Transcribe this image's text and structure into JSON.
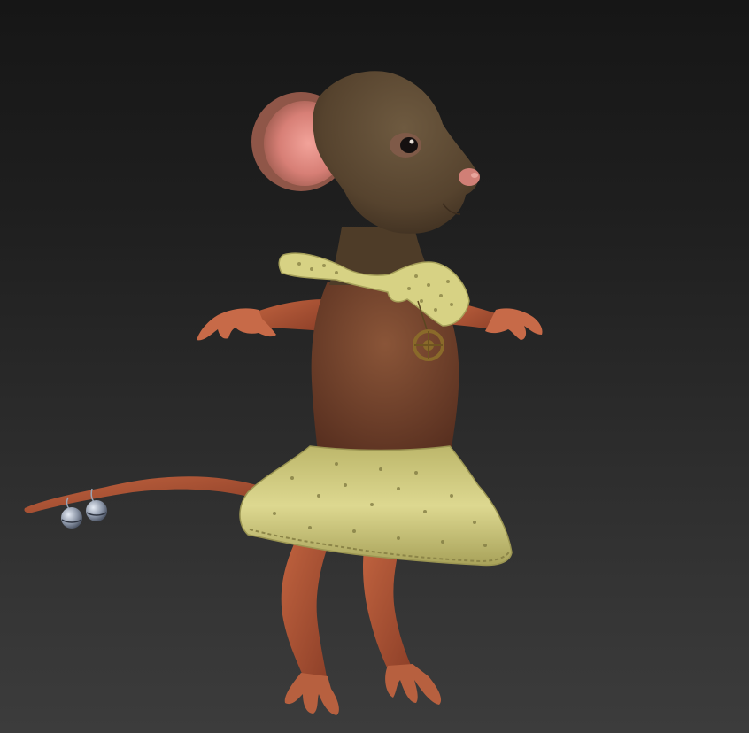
{
  "scene": {
    "subject": "mouse-character",
    "colors": {
      "background_top": "#161616",
      "background_bottom": "#3c3c3c",
      "skin_head": "#5e4a33",
      "skin_body": "#7a4631",
      "skin_limbs": "#b25a3b",
      "ear_inner": "#e6908a",
      "fabric": "#d9d48a",
      "fabric_shadow": "#a9a35c",
      "bell_metal": "#9aa4b4",
      "pendant_gold": "#8a6a2a"
    }
  }
}
